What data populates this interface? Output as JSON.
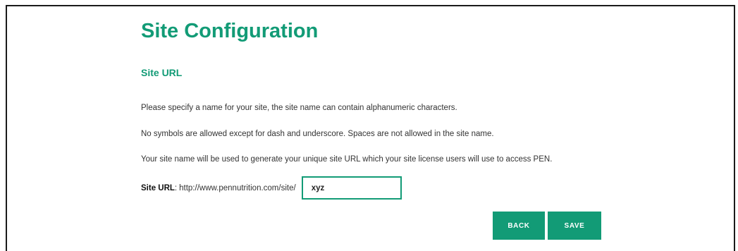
{
  "page": {
    "title": "Site Configuration",
    "subtitle": "Site URL"
  },
  "instructions": [
    "Please specify a name for your site, the site name can contain alphanumeric characters.",
    "No symbols are allowed except for dash and underscore. Spaces are not allowed in the site name.",
    "Your site name will be used to generate your unique site URL which your site license users will use to access PEN."
  ],
  "site_url": {
    "label": "Site URL",
    "separator": ":",
    "prefix": "http://www.pennutrition.com/site/",
    "value": "xyz"
  },
  "actions": {
    "back_label": "BACK",
    "save_label": "SAVE"
  },
  "colors": {
    "accent": "#129b76",
    "frame_border": "#1a1a1a",
    "text": "#333333"
  }
}
